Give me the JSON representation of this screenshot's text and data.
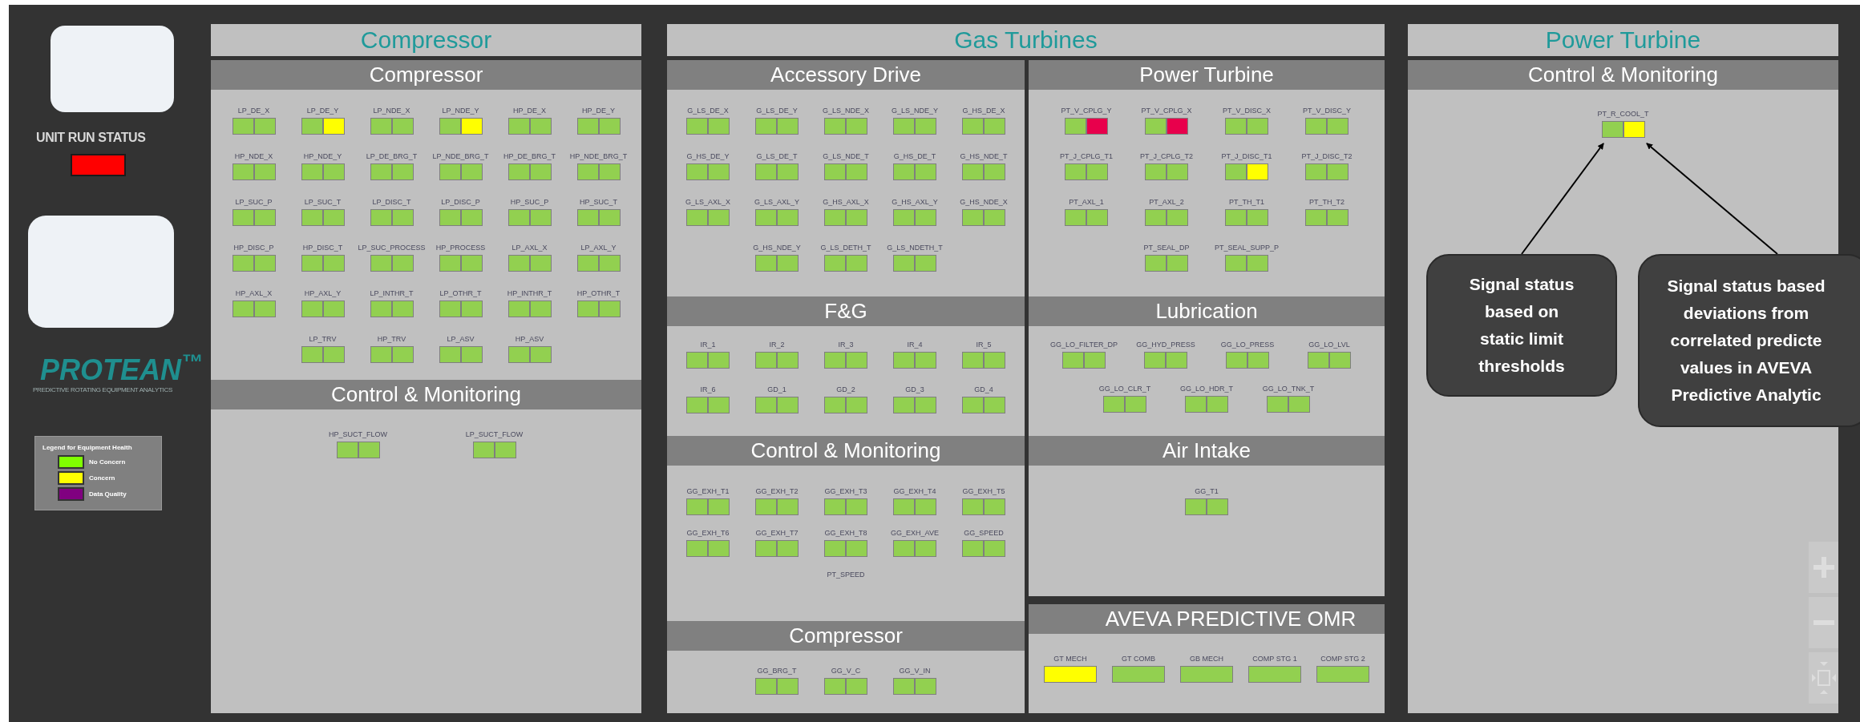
{
  "sidebar": {
    "unit_run_status": {
      "label": "UNIT RUN STATUS",
      "color": "#ff0000"
    },
    "logo": {
      "name": "PROTEAN$^{™}$",
      "tagline": "PREDICTIVE ROTATING EQUIPMENT ANALYTICS"
    },
    "legend": {
      "title": "Legend for Equipment Health",
      "items": [
        {
          "label": "No Concern",
          "color": "#80ff00"
        },
        {
          "label": "Concern",
          "color": "#ffff00"
        },
        {
          "label": "Data Quality",
          "color": "#800080"
        }
      ]
    }
  },
  "compressor": {
    "title": "Compressor",
    "sections": [
      {
        "title": "Compressor",
        "rows": [
          {
            "signals": [
              {
                "label": "LP_DE_X",
                "cells": [
                  {
                    "color": "#92d050"
                  },
                  {
                    "color": "#92d050"
                  }
                ]
              },
              {
                "label": "LP_DE_Y",
                "cells": [
                  {
                    "color": "#92d050"
                  },
                  {
                    "color": "#ffff00"
                  }
                ]
              },
              {
                "label": "LP_NDE_X",
                "cells": [
                  {
                    "color": "#92d050"
                  },
                  {
                    "color": "#92d050"
                  }
                ]
              },
              {
                "label": "LP_NDE_Y",
                "cells": [
                  {
                    "color": "#92d050"
                  },
                  {
                    "color": "#ffff00"
                  }
                ]
              },
              {
                "label": "HP_DE_X",
                "cells": [
                  {
                    "color": "#92d050"
                  },
                  {
                    "color": "#92d050"
                  }
                ]
              },
              {
                "label": "HP_DE_Y",
                "cells": [
                  {
                    "color": "#92d050"
                  },
                  {
                    "color": "#92d050"
                  }
                ]
              }
            ]
          },
          {
            "signals": [
              {
                "label": "HP_NDE_X",
                "cells": [
                  {
                    "color": "#92d050"
                  },
                  {
                    "color": "#92d050"
                  }
                ]
              },
              {
                "label": "HP_NDE_Y",
                "cells": [
                  {
                    "color": "#92d050"
                  },
                  {
                    "color": "#92d050"
                  }
                ]
              },
              {
                "label": "LP_DE_BRG_T",
                "cells": [
                  {
                    "color": "#92d050"
                  },
                  {
                    "color": "#92d050"
                  }
                ]
              },
              {
                "label": "LP_NDE_BRG_T",
                "cells": [
                  {
                    "color": "#92d050"
                  },
                  {
                    "color": "#92d050"
                  }
                ]
              },
              {
                "label": "HP_DE_BRG_T",
                "cells": [
                  {
                    "color": "#92d050"
                  },
                  {
                    "color": "#92d050"
                  }
                ]
              },
              {
                "label": "HP_NDE_BRG_T",
                "cells": [
                  {
                    "color": "#92d050"
                  },
                  {
                    "color": "#92d050"
                  }
                ]
              }
            ]
          },
          {
            "signals": [
              {
                "label": "LP_SUC_P",
                "cells": [
                  {
                    "color": "#92d050"
                  },
                  {
                    "color": "#92d050"
                  }
                ]
              },
              {
                "label": "LP_SUC_T",
                "cells": [
                  {
                    "color": "#92d050"
                  },
                  {
                    "color": "#92d050"
                  }
                ]
              },
              {
                "label": "LP_DISC_T",
                "cells": [
                  {
                    "color": "#92d050"
                  },
                  {
                    "color": "#92d050"
                  }
                ]
              },
              {
                "label": "LP_DISC_P",
                "cells": [
                  {
                    "color": "#92d050"
                  },
                  {
                    "color": "#92d050"
                  }
                ]
              },
              {
                "label": "HP_SUC_P",
                "cells": [
                  {
                    "color": "#92d050"
                  },
                  {
                    "color": "#92d050"
                  }
                ]
              },
              {
                "label": "HP_SUC_T",
                "cells": [
                  {
                    "color": "#92d050"
                  },
                  {
                    "color": "#92d050"
                  }
                ]
              }
            ]
          },
          {
            "signals": [
              {
                "label": "HP_DISC_P",
                "cells": [
                  {
                    "color": "#92d050"
                  },
                  {
                    "color": "#92d050"
                  }
                ]
              },
              {
                "label": "HP_DISC_T",
                "cells": [
                  {
                    "color": "#92d050"
                  },
                  {
                    "color": "#92d050"
                  }
                ]
              },
              {
                "label": "LP_SUC_PROCESS",
                "cells": [
                  {
                    "color": "#92d050"
                  },
                  {
                    "color": "#92d050"
                  }
                ]
              },
              {
                "label": "HP_PROCESS",
                "cells": [
                  {
                    "color": "#92d050"
                  },
                  {
                    "color": "#92d050"
                  }
                ]
              },
              {
                "label": "LP_AXL_X",
                "cells": [
                  {
                    "color": "#92d050"
                  },
                  {
                    "color": "#92d050"
                  }
                ]
              },
              {
                "label": "LP_AXL_Y",
                "cells": [
                  {
                    "color": "#92d050"
                  },
                  {
                    "color": "#92d050"
                  }
                ]
              }
            ]
          },
          {
            "signals": [
              {
                "label": "HP_AXL_X",
                "cells": [
                  {
                    "color": "#92d050"
                  },
                  {
                    "color": "#92d050"
                  }
                ]
              },
              {
                "label": "HP_AXL_Y",
                "cells": [
                  {
                    "color": "#92d050"
                  },
                  {
                    "color": "#92d050"
                  }
                ]
              },
              {
                "label": "LP_INTHR_T",
                "cells": [
                  {
                    "color": "#92d050"
                  },
                  {
                    "color": "#92d050"
                  }
                ]
              },
              {
                "label": "LP_OTHR_T",
                "cells": [
                  {
                    "color": "#92d050"
                  },
                  {
                    "color": "#92d050"
                  }
                ]
              },
              {
                "label": "HP_INTHR_T",
                "cells": [
                  {
                    "color": "#92d050"
                  },
                  {
                    "color": "#92d050"
                  }
                ]
              },
              {
                "label": "HP_OTHR_T",
                "cells": [
                  {
                    "color": "#92d050"
                  },
                  {
                    "color": "#92d050"
                  }
                ]
              }
            ]
          },
          {
            "signals": [
              {
                "label": "LP_TRV",
                "cells": [
                  {
                    "color": "#92d050"
                  },
                  {
                    "color": "#92d050"
                  }
                ]
              },
              {
                "label": "HP_TRV",
                "cells": [
                  {
                    "color": "#92d050"
                  },
                  {
                    "color": "#92d050"
                  }
                ]
              },
              {
                "label": "LP_ASV",
                "cells": [
                  {
                    "color": "#92d050"
                  },
                  {
                    "color": "#92d050"
                  }
                ]
              },
              {
                "label": "HP_ASV",
                "cells": [
                  {
                    "color": "#92d050"
                  },
                  {
                    "color": "#92d050"
                  }
                ]
              }
            ]
          }
        ]
      },
      {
        "title": "Control & Monitoring",
        "rows": [
          {
            "signals": [
              {
                "label": "HP_SUCT_FLOW",
                "cells": [
                  {
                    "color": "#92d050"
                  },
                  {
                    "color": "#92d050"
                  }
                ]
              },
              {
                "label": "LP_SUCT_FLOW",
                "cells": [
                  {
                    "color": "#92d050"
                  },
                  {
                    "color": "#92d050"
                  }
                ]
              }
            ]
          }
        ]
      }
    ]
  },
  "gas_turbines": {
    "title": "Gas Turbines",
    "left": [
      {
        "title": "Accessory Drive",
        "rows": [
          {
            "signals": [
              {
                "label": "G_LS_DE_X",
                "cells": [
                  {
                    "color": "#92d050"
                  },
                  {
                    "color": "#92d050"
                  }
                ]
              },
              {
                "label": "G_LS_DE_Y",
                "cells": [
                  {
                    "color": "#92d050"
                  },
                  {
                    "color": "#92d050"
                  }
                ]
              },
              {
                "label": "G_LS_NDE_X",
                "cells": [
                  {
                    "color": "#92d050"
                  },
                  {
                    "color": "#92d050"
                  }
                ]
              },
              {
                "label": "G_LS_NDE_Y",
                "cells": [
                  {
                    "color": "#92d050"
                  },
                  {
                    "color": "#92d050"
                  }
                ]
              },
              {
                "label": "G_HS_DE_X",
                "cells": [
                  {
                    "color": "#92d050"
                  },
                  {
                    "color": "#92d050"
                  }
                ]
              }
            ]
          },
          {
            "signals": [
              {
                "label": "G_HS_DE_Y",
                "cells": [
                  {
                    "color": "#92d050"
                  },
                  {
                    "color": "#92d050"
                  }
                ]
              },
              {
                "label": "G_LS_DE_T",
                "cells": [
                  {
                    "color": "#92d050"
                  },
                  {
                    "color": "#92d050"
                  }
                ]
              },
              {
                "label": "G_LS_NDE_T",
                "cells": [
                  {
                    "color": "#92d050"
                  },
                  {
                    "color": "#92d050"
                  }
                ]
              },
              {
                "label": "G_HS_DE_T",
                "cells": [
                  {
                    "color": "#92d050"
                  },
                  {
                    "color": "#92d050"
                  }
                ]
              },
              {
                "label": "G_HS_NDE_T",
                "cells": [
                  {
                    "color": "#92d050"
                  },
                  {
                    "color": "#92d050"
                  }
                ]
              }
            ]
          },
          {
            "signals": [
              {
                "label": "G_LS_AXL_X",
                "cells": [
                  {
                    "color": "#92d050"
                  },
                  {
                    "color": "#92d050"
                  }
                ]
              },
              {
                "label": "G_LS_AXL_Y",
                "cells": [
                  {
                    "color": "#92d050"
                  },
                  {
                    "color": "#92d050"
                  }
                ]
              },
              {
                "label": "G_HS_AXL_X",
                "cells": [
                  {
                    "color": "#92d050"
                  },
                  {
                    "color": "#92d050"
                  }
                ]
              },
              {
                "label": "G_HS_AXL_Y",
                "cells": [
                  {
                    "color": "#92d050"
                  },
                  {
                    "color": "#92d050"
                  }
                ]
              },
              {
                "label": "G_HS_NDE_X",
                "cells": [
                  {
                    "color": "#92d050"
                  },
                  {
                    "color": "#92d050"
                  }
                ]
              }
            ]
          },
          {
            "signals": [
              {
                "label": "G_HS_NDE_Y",
                "cells": [
                  {
                    "color": "#92d050"
                  },
                  {
                    "color": "#92d050"
                  }
                ]
              },
              {
                "label": "G_LS_DETH_T",
                "cells": [
                  {
                    "color": "#92d050"
                  },
                  {
                    "color": "#92d050"
                  }
                ]
              },
              {
                "label": "G_LS_NDETH_T",
                "cells": [
                  {
                    "color": "#92d050"
                  },
                  {
                    "color": "#92d050"
                  }
                ]
              }
            ]
          }
        ]
      },
      {
        "title": "F&G",
        "rows": [
          {
            "signals": [
              {
                "label": "IR_1",
                "cells": [
                  {
                    "color": "#92d050"
                  },
                  {
                    "color": "#92d050"
                  }
                ]
              },
              {
                "label": "IR_2",
                "cells": [
                  {
                    "color": "#92d050"
                  },
                  {
                    "color": "#92d050"
                  }
                ]
              },
              {
                "label": "IR_3",
                "cells": [
                  {
                    "color": "#92d050"
                  },
                  {
                    "color": "#92d050"
                  }
                ]
              },
              {
                "label": "IR_4",
                "cells": [
                  {
                    "color": "#92d050"
                  },
                  {
                    "color": "#92d050"
                  }
                ]
              },
              {
                "label": "IR_5",
                "cells": [
                  {
                    "color": "#92d050"
                  },
                  {
                    "color": "#92d050"
                  }
                ]
              }
            ]
          },
          {
            "signals": [
              {
                "label": "IR_6",
                "cells": [
                  {
                    "color": "#92d050"
                  },
                  {
                    "color": "#92d050"
                  }
                ]
              },
              {
                "label": "GD_1",
                "cells": [
                  {
                    "color": "#92d050"
                  },
                  {
                    "color": "#92d050"
                  }
                ]
              },
              {
                "label": "GD_2",
                "cells": [
                  {
                    "color": "#92d050"
                  },
                  {
                    "color": "#92d050"
                  }
                ]
              },
              {
                "label": "GD_3",
                "cells": [
                  {
                    "color": "#92d050"
                  },
                  {
                    "color": "#92d050"
                  }
                ]
              },
              {
                "label": "GD_4",
                "cells": [
                  {
                    "color": "#92d050"
                  },
                  {
                    "color": "#92d050"
                  }
                ]
              }
            ]
          }
        ]
      },
      {
        "title": "Control & Monitoring",
        "rows": [
          {
            "signals": [
              {
                "label": "GG_EXH_T1",
                "cells": [
                  {
                    "color": "#92d050"
                  },
                  {
                    "color": "#92d050"
                  }
                ]
              },
              {
                "label": "GG_EXH_T2",
                "cells": [
                  {
                    "color": "#92d050"
                  },
                  {
                    "color": "#92d050"
                  }
                ]
              },
              {
                "label": "GG_EXH_T3",
                "cells": [
                  {
                    "color": "#92d050"
                  },
                  {
                    "color": "#92d050"
                  }
                ]
              },
              {
                "label": "GG_EXH_T4",
                "cells": [
                  {
                    "color": "#92d050"
                  },
                  {
                    "color": "#92d050"
                  }
                ]
              },
              {
                "label": "GG_EXH_T5",
                "cells": [
                  {
                    "color": "#92d050"
                  },
                  {
                    "color": "#92d050"
                  }
                ]
              }
            ]
          },
          {
            "signals": [
              {
                "label": "GG_EXH_T6",
                "cells": [
                  {
                    "color": "#92d050"
                  },
                  {
                    "color": "#92d050"
                  }
                ]
              },
              {
                "label": "GG_EXH_T7",
                "cells": [
                  {
                    "color": "#92d050"
                  },
                  {
                    "color": "#92d050"
                  }
                ]
              },
              {
                "label": "GG_EXH_T8",
                "cells": [
                  {
                    "color": "#92d050"
                  },
                  {
                    "color": "#92d050"
                  }
                ]
              },
              {
                "label": "GG_EXH_AVE",
                "cells": [
                  {
                    "color": "#92d050"
                  },
                  {
                    "color": "#92d050"
                  }
                ]
              },
              {
                "label": "GG_SPEED",
                "cells": [
                  {
                    "color": "#92d050"
                  },
                  {
                    "color": "#92d050"
                  }
                ]
              }
            ]
          },
          {
            "signals": [
              {
                "label": "PT_SPEED"
              }
            ]
          }
        ]
      },
      {
        "title": "Compressor",
        "rows": [
          {
            "signals": [
              {
                "label": "GG_BRG_T",
                "cells": [
                  {
                    "color": "#92d050"
                  },
                  {
                    "color": "#92d050"
                  }
                ]
              },
              {
                "label": "GG_V_C",
                "cells": [
                  {
                    "color": "#92d050"
                  },
                  {
                    "color": "#92d050"
                  }
                ]
              },
              {
                "label": "GG_V_IN",
                "cells": [
                  {
                    "color": "#92d050"
                  },
                  {
                    "color": "#92d050"
                  }
                ]
              }
            ]
          }
        ]
      }
    ],
    "right": [
      {
        "title": "Power Turbine",
        "rows": [
          {
            "signals": [
              {
                "label": "PT_V_CPLG_Y",
                "cells": [
                  {
                    "color": "#92d050"
                  },
                  {
                    "color": "#e8004c"
                  }
                ]
              },
              {
                "label": "PT_V_CPLG_X",
                "cells": [
                  {
                    "color": "#92d050"
                  },
                  {
                    "color": "#e8004c"
                  }
                ]
              },
              {
                "label": "PT_V_DISC_X",
                "cells": [
                  {
                    "color": "#92d050"
                  },
                  {
                    "color": "#92d050"
                  }
                ]
              },
              {
                "label": "PT_V_DISC_Y",
                "cells": [
                  {
                    "color": "#92d050"
                  },
                  {
                    "color": "#92d050"
                  }
                ]
              }
            ]
          },
          {
            "signals": [
              {
                "label": "PT_J_CPLG_T1",
                "cells": [
                  {
                    "color": "#92d050"
                  },
                  {
                    "color": "#92d050"
                  }
                ]
              },
              {
                "label": "PT_J_CPLG_T2",
                "cells": [
                  {
                    "color": "#92d050"
                  },
                  {
                    "color": "#92d050"
                  }
                ]
              },
              {
                "label": "PT_J_DISC_T1",
                "cells": [
                  {
                    "color": "#92d050"
                  },
                  {
                    "color": "#ffff00"
                  }
                ]
              },
              {
                "label": "PT_J_DISC_T2",
                "cells": [
                  {
                    "color": "#92d050"
                  },
                  {
                    "color": "#92d050"
                  }
                ]
              }
            ]
          },
          {
            "signals": [
              {
                "label": "PT_AXL_1",
                "cells": [
                  {
                    "color": "#92d050"
                  },
                  {
                    "color": "#92d050"
                  }
                ]
              },
              {
                "label": "PT_AXL_2",
                "cells": [
                  {
                    "color": "#92d050"
                  },
                  {
                    "color": "#92d050"
                  }
                ]
              },
              {
                "label": "PT_TH_T1",
                "cells": [
                  {
                    "color": "#92d050"
                  },
                  {
                    "color": "#92d050"
                  }
                ]
              },
              {
                "label": "PT_TH_T2",
                "cells": [
                  {
                    "color": "#92d050"
                  },
                  {
                    "color": "#92d050"
                  }
                ]
              }
            ]
          },
          {
            "signals": [
              {
                "label": "PT_SEAL_DP",
                "cells": [
                  {
                    "color": "#92d050"
                  },
                  {
                    "color": "#92d050"
                  }
                ]
              },
              {
                "label": "PT_SEAL_SUPP_P",
                "cells": [
                  {
                    "color": "#92d050"
                  },
                  {
                    "color": "#92d050"
                  }
                ]
              }
            ]
          }
        ]
      },
      {
        "title": "Lubrication",
        "rows": [
          {
            "signals": [
              {
                "label": "GG_LO_FILTER_DP",
                "cells": [
                  {
                    "color": "#92d050"
                  },
                  {
                    "color": "#92d050"
                  }
                ]
              },
              {
                "label": "GG_HYD_PRESS",
                "cells": [
                  {
                    "color": "#92d050"
                  },
                  {
                    "color": "#92d050"
                  }
                ]
              },
              {
                "label": "GG_LO_PRESS",
                "cells": [
                  {
                    "color": "#92d050"
                  },
                  {
                    "color": "#92d050"
                  }
                ]
              },
              {
                "label": "GG_LO_LVL",
                "cells": [
                  {
                    "color": "#92d050"
                  },
                  {
                    "color": "#92d050"
                  }
                ]
              }
            ]
          },
          {
            "signals": [
              {
                "label": "GG_LO_CLR_T",
                "cells": [
                  {
                    "color": "#92d050"
                  },
                  {
                    "color": "#92d050"
                  }
                ]
              },
              {
                "label": "GG_LO_HDR_T",
                "cells": [
                  {
                    "color": "#92d050"
                  },
                  {
                    "color": "#92d050"
                  }
                ]
              },
              {
                "label": "GG_LO_TNK_T",
                "cells": [
                  {
                    "color": "#92d050"
                  },
                  {
                    "color": "#92d050"
                  }
                ]
              }
            ]
          }
        ]
      },
      {
        "title": "Air Intake",
        "rows": [
          {
            "signals": [
              {
                "label": "GG_T1",
                "cells": [
                  {
                    "color": "#92d050"
                  },
                  {
                    "color": "#92d050"
                  }
                ]
              }
            ]
          }
        ]
      }
    ],
    "omr": {
      "title": "AVEVA PREDICTIVE OMR",
      "items": [
        {
          "label": "GT MECH",
          "color": "#ffff00"
        },
        {
          "label": "GT COMB",
          "color": "#92d050"
        },
        {
          "label": "GB MECH",
          "color": "#92d050"
        },
        {
          "label": "COMP STG 1",
          "color": "#92d050"
        },
        {
          "label": "COMP STG 2",
          "color": "#92d050"
        }
      ]
    }
  },
  "power_turbine": {
    "title": "Power Turbine",
    "section": {
      "title": "Control & Monitoring",
      "rows": [
        {
          "signals": [
            {
              "label": "PT_R_COOL_T",
              "cells": [
                {
                  "color": "#92d050"
                },
                {
                  "color": "#ffff00"
                }
              ]
            }
          ]
        }
      ]
    },
    "callouts": [
      {
        "lines": [
          "Signal status",
          "based on",
          "static limit",
          "thresholds"
        ]
      },
      {
        "lines": [
          "Signal status based",
          "deviations from",
          "correlated predicte",
          "values in AVEVA",
          "Predictive Analytic"
        ]
      }
    ]
  }
}
